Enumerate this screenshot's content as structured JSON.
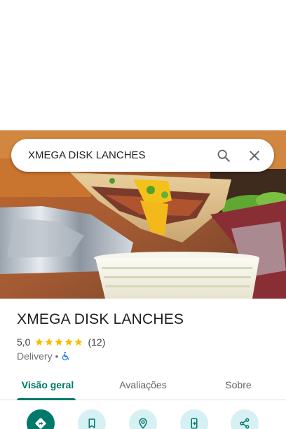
{
  "search": {
    "query": "XMEGA DISK LANCHES"
  },
  "place": {
    "name": "XMEGA DISK LANCHES",
    "rating": "5,0",
    "rating_value": 5.0,
    "review_count": "(12)",
    "category": "Delivery",
    "separator": "•"
  },
  "tabs": [
    {
      "label": "Visão geral",
      "active": true
    },
    {
      "label": "Avaliações",
      "active": false
    },
    {
      "label": "Sobre",
      "active": false
    }
  ],
  "actions": [
    {
      "icon": "directions-icon"
    },
    {
      "icon": "bookmark-icon"
    },
    {
      "icon": "nearby-icon"
    },
    {
      "icon": "send-to-phone-icon"
    },
    {
      "icon": "share-icon"
    }
  ],
  "colors": {
    "accent": "#00796b",
    "star": "#fbbc04",
    "accessibility": "#1a73e8",
    "action_bg": "#d6f0f4"
  }
}
